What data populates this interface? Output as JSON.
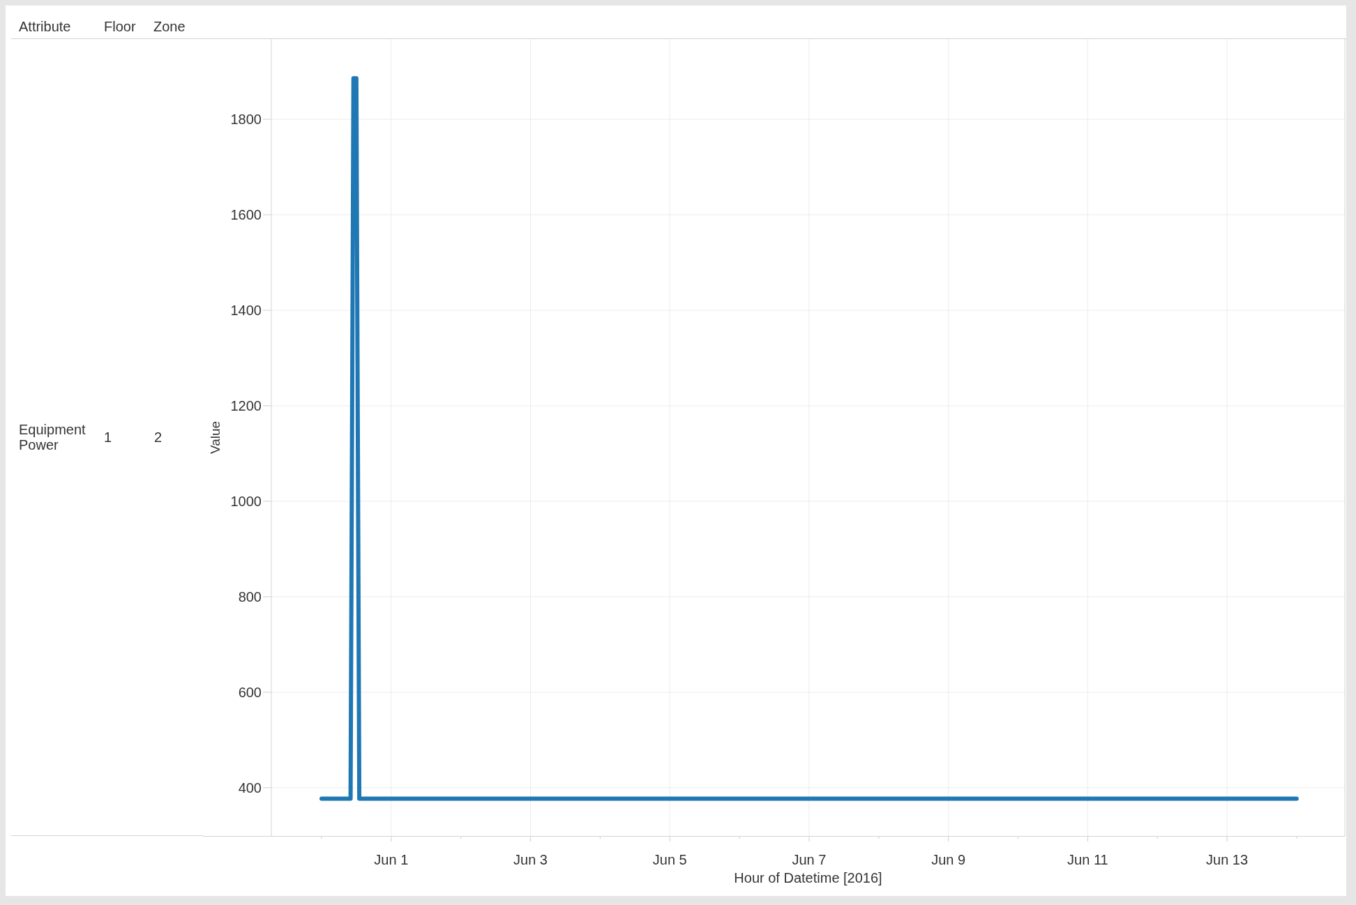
{
  "headers": [
    "Attribute",
    "Floor",
    "Zone"
  ],
  "rows": [
    {
      "attribute": "Equipment Power",
      "floor": "1",
      "zone": "2"
    }
  ],
  "chart_data": {
    "type": "line",
    "xlabel": "Hour of Datetime [2016]",
    "ylabel": "Value",
    "categories": [
      null,
      null,
      null,
      null,
      null,
      null,
      null,
      null,
      null,
      null,
      null,
      null,
      null,
      null,
      null,
      null,
      null,
      null,
      null,
      null,
      null,
      null,
      null,
      null,
      "Jun 1",
      null,
      null,
      null,
      null,
      null,
      null,
      null,
      null,
      null,
      null,
      null,
      null,
      null,
      null,
      null,
      null,
      null,
      null,
      null,
      null,
      null,
      null,
      null,
      null,
      null,
      null,
      null,
      null,
      null,
      null,
      null,
      null,
      null,
      null,
      null,
      null,
      null,
      null,
      null,
      null,
      null,
      null,
      null,
      null,
      null,
      null,
      null,
      "Jun 3",
      null,
      null,
      null,
      null,
      null,
      null,
      null,
      null,
      null,
      null,
      null,
      null,
      null,
      null,
      null,
      null,
      null,
      null,
      null,
      null,
      null,
      null,
      null,
      null,
      null,
      null,
      null,
      null,
      null,
      null,
      null,
      null,
      null,
      null,
      null,
      null,
      null,
      null,
      null,
      null,
      null,
      null,
      null,
      null,
      null,
      null,
      null,
      "Jun 5",
      null,
      null,
      null,
      null,
      null,
      null,
      null,
      null,
      null,
      null,
      null,
      null,
      null,
      null,
      null,
      null,
      null,
      null,
      null,
      null,
      null,
      null,
      null,
      null,
      null,
      null,
      null,
      null,
      null,
      null,
      null,
      null,
      null,
      null,
      null,
      null,
      null,
      null,
      null,
      null,
      null,
      null,
      null,
      null,
      null,
      null,
      null,
      "Jun 7",
      null,
      null,
      null,
      null,
      null,
      null,
      null,
      null,
      null,
      null,
      null,
      null,
      null,
      null,
      null,
      null,
      null,
      null,
      null,
      null,
      null,
      null,
      null,
      null,
      null,
      null,
      null,
      null,
      null,
      null,
      null,
      null,
      null,
      null,
      null,
      null,
      null,
      null,
      null,
      null,
      null,
      null,
      null,
      null,
      null,
      null,
      null,
      "Jun 9",
      null,
      null,
      null,
      null,
      null,
      null,
      null,
      null,
      null,
      null,
      null,
      null,
      null,
      null,
      null,
      null,
      null,
      null,
      null,
      null,
      null,
      null,
      null,
      null,
      null,
      null,
      null,
      null,
      null,
      null,
      null,
      null,
      null,
      null,
      null,
      null,
      null,
      null,
      null,
      null,
      null,
      null,
      null,
      null,
      null,
      null,
      null,
      "Jun 11",
      null,
      null,
      null,
      null,
      null,
      null,
      null,
      null,
      null,
      null,
      null,
      null,
      null,
      null,
      null,
      null,
      null,
      null,
      null,
      null,
      null,
      null,
      null,
      null,
      null,
      null,
      null,
      null,
      null,
      null,
      null,
      null,
      null,
      null,
      null,
      null,
      null,
      null,
      null,
      null,
      null,
      null,
      null,
      null,
      null,
      null,
      null,
      "Jun 13",
      null,
      null,
      null,
      null,
      null,
      null,
      null,
      null,
      null,
      null,
      null,
      null,
      null,
      null,
      null,
      null,
      null,
      null,
      null,
      null,
      null,
      null,
      null,
      null
    ],
    "values": [
      377,
      377,
      377,
      377,
      377,
      377,
      377,
      377,
      377,
      377,
      377,
      1886,
      1886,
      377,
      377,
      377,
      377,
      377,
      377,
      377,
      377,
      377,
      377,
      377,
      377,
      377,
      377,
      377,
      377,
      377,
      377,
      377,
      377,
      377,
      377,
      377,
      377,
      377,
      377,
      377,
      377,
      377,
      377,
      377,
      377,
      377,
      377,
      377,
      377,
      377,
      377,
      377,
      377,
      377,
      377,
      377,
      377,
      377,
      377,
      377,
      377,
      377,
      377,
      377,
      377,
      377,
      377,
      377,
      377,
      377,
      377,
      377,
      377,
      377,
      377,
      377,
      377,
      377,
      377,
      377,
      377,
      377,
      377,
      377,
      377,
      377,
      377,
      377,
      377,
      377,
      377,
      377,
      377,
      377,
      377,
      377,
      377,
      377,
      377,
      377,
      377,
      377,
      377,
      377,
      377,
      377,
      377,
      377,
      377,
      377,
      377,
      377,
      377,
      377,
      377,
      377,
      377,
      377,
      377,
      377,
      377,
      377,
      377,
      377,
      377,
      377,
      377,
      377,
      377,
      377,
      377,
      377,
      377,
      377,
      377,
      377,
      377,
      377,
      377,
      377,
      377,
      377,
      377,
      377,
      377,
      377,
      377,
      377,
      377,
      377,
      377,
      377,
      377,
      377,
      377,
      377,
      377,
      377,
      377,
      377,
      377,
      377,
      377,
      377,
      377,
      377,
      377,
      377,
      377,
      377,
      377,
      377,
      377,
      377,
      377,
      377,
      377,
      377,
      377,
      377,
      377,
      377,
      377,
      377,
      377,
      377,
      377,
      377,
      377,
      377,
      377,
      377,
      377,
      377,
      377,
      377,
      377,
      377,
      377,
      377,
      377,
      377,
      377,
      377,
      377,
      377,
      377,
      377,
      377,
      377,
      377,
      377,
      377,
      377,
      377,
      377,
      377,
      377,
      377,
      377,
      377,
      377,
      377,
      377,
      377,
      377,
      377,
      377,
      377,
      377,
      377,
      377,
      377,
      377,
      377,
      377,
      377,
      377,
      377,
      377,
      377,
      377,
      377,
      377,
      377,
      377,
      377,
      377,
      377,
      377,
      377,
      377,
      377,
      377,
      377,
      377,
      377,
      377,
      377,
      377,
      377,
      377,
      377,
      377,
      377,
      377,
      377,
      377,
      377,
      377,
      377,
      377,
      377,
      377,
      377,
      377,
      377,
      377,
      377,
      377,
      377,
      377,
      377,
      377,
      377,
      377,
      377,
      377,
      377,
      377,
      377,
      377,
      377,
      377,
      377,
      377,
      377,
      377,
      377,
      377,
      377,
      377,
      377,
      377,
      377,
      377,
      377,
      377,
      377,
      377,
      377,
      377,
      377,
      377,
      377,
      377,
      377,
      377,
      377,
      377,
      377,
      377,
      377,
      377,
      377,
      377,
      377,
      377,
      377,
      377,
      377,
      377,
      377,
      377,
      377,
      377,
      377
    ],
    "grid": true,
    "ylim": [
      299,
      1968
    ],
    "yticks": [
      400,
      600,
      800,
      1000,
      1200,
      1400,
      1600,
      1800
    ]
  }
}
